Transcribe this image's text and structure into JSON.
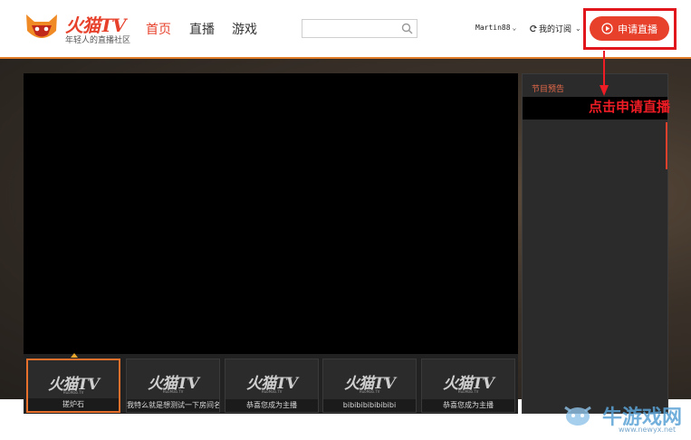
{
  "header": {
    "brand": "火猫TV",
    "slogan": "年轻人的直播社区",
    "nav": [
      {
        "label": "首页",
        "active": true
      },
      {
        "label": "直播",
        "active": false
      },
      {
        "label": "游戏",
        "active": false
      }
    ],
    "search": {
      "value": "",
      "placeholder": ""
    },
    "user": {
      "name": "Martin88"
    },
    "subscriptions": {
      "label": "我的订阅"
    },
    "apply_button": {
      "label": "申请直播"
    },
    "accent_color": "#e7412c"
  },
  "player": {
    "thumbnails": [
      {
        "logo": "火猫TV",
        "sub": "HuoMao.TV",
        "caption": "搓炉石"
      },
      {
        "logo": "火猫TV",
        "sub": "HuoMao.TV",
        "caption": "我特么就是想测试一下房间名"
      },
      {
        "logo": "火猫TV",
        "sub": "HuoMao.TV",
        "caption": "恭喜您成为主播"
      },
      {
        "logo": "火猫TV",
        "sub": "HuoMao.TV",
        "caption": "bibibibibibibibi"
      },
      {
        "logo": "火猫TV",
        "sub": "HuoMao.TV",
        "caption": "恭喜您成为主播"
      }
    ]
  },
  "schedule": {
    "title": "节目预告"
  },
  "annotation": {
    "text": "点击申请直播",
    "color": "#ee1c24"
  },
  "watermark": {
    "text": "牛游戏网",
    "url": "www.newyx.net"
  }
}
